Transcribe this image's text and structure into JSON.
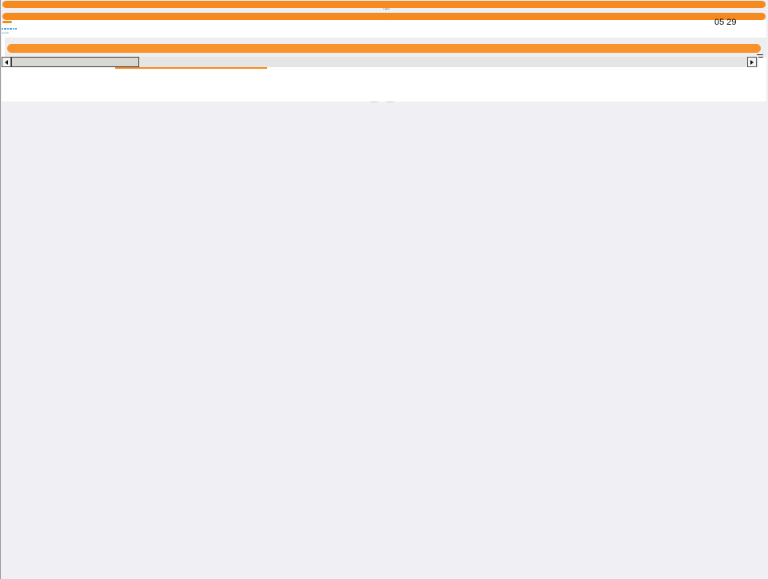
{
  "header": {
    "center_label": "Label",
    "marker_text": "·"
  },
  "status": {
    "clock_text": "05 29",
    "link_text": "search"
  },
  "colors": {
    "accent_orange": "#f68a1e",
    "accent_orange_light": "#f8922a",
    "page_background": "#efeff4",
    "panel_background": "#ffffff",
    "scrollbar_track": "#e6e5e3",
    "dot_blue": "#1d8fe0",
    "link_blue": "#3d8fd6"
  },
  "icons": {
    "dots": "ellipsis-dots-icon",
    "menu": "hamburger-menu-icon",
    "scroll_left": "triangle-left-icon",
    "scroll_right": "triangle-right-icon"
  },
  "dots_count": 6
}
